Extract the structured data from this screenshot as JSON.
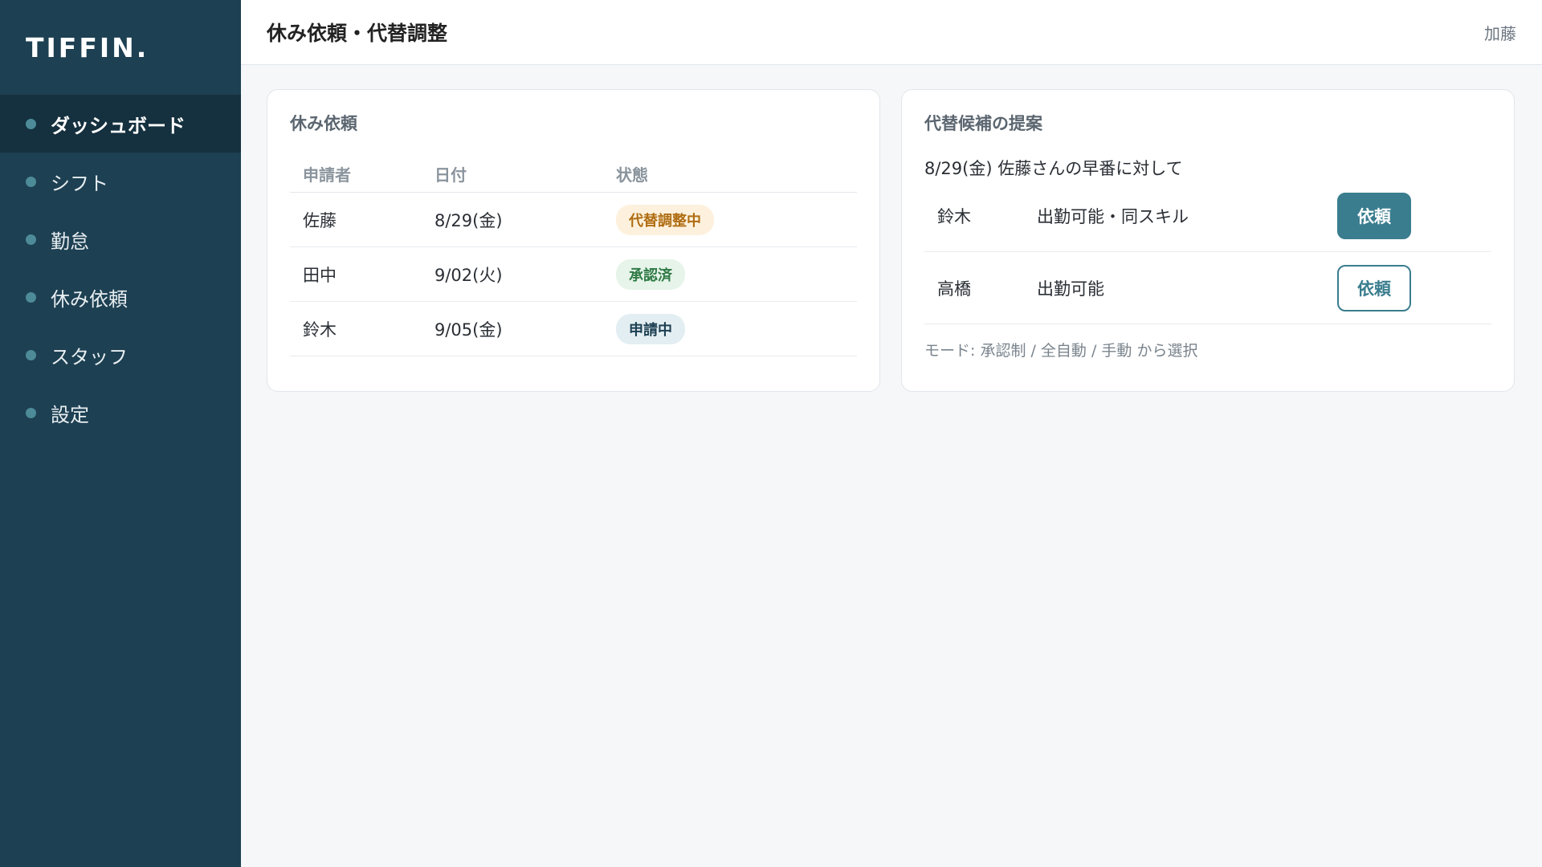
{
  "app": {
    "logo": "TIFFIN."
  },
  "sidebar": {
    "items": [
      {
        "label": "ダッシュボード",
        "active": true
      },
      {
        "label": "シフト"
      },
      {
        "label": "勤怠"
      },
      {
        "label": "休み依頼"
      },
      {
        "label": "スタッフ"
      },
      {
        "label": "設定"
      }
    ]
  },
  "header": {
    "title": "休み依頼・代替調整",
    "user": "加藤"
  },
  "requests": {
    "title": "休み依頼",
    "columns": [
      "申請者",
      "日付",
      "状態"
    ],
    "rows": [
      {
        "name": "佐藤",
        "date": "8/29(金)",
        "status": "代替調整中",
        "status_bg": "#fdf1dd",
        "status_color": "#b06d12"
      },
      {
        "name": "田中",
        "date": "9/02(火)",
        "status": "承認済",
        "status_bg": "#e6f4ea",
        "status_color": "#2f7a45"
      },
      {
        "name": "鈴木",
        "date": "9/05(金)",
        "status": "申請中",
        "status_bg": "#e3eef2",
        "status_color": "#1d4052"
      }
    ]
  },
  "suggestion": {
    "title": "代替候補の提案",
    "subtitle": "8/29(金) 佐藤さんの早番に対して",
    "candidates": [
      {
        "name": "鈴木",
        "desc": "出勤可能・同スキル",
        "button": "依頼",
        "style": "primary"
      },
      {
        "name": "高橋",
        "desc": "出勤可能",
        "button": "依頼",
        "style": "outline"
      }
    ],
    "mode_note": "モード: 承認制 / 全自動 / 手動 から選択"
  },
  "colors": {
    "sidebar": "#1d4052",
    "accent": "#3a7d8e"
  }
}
